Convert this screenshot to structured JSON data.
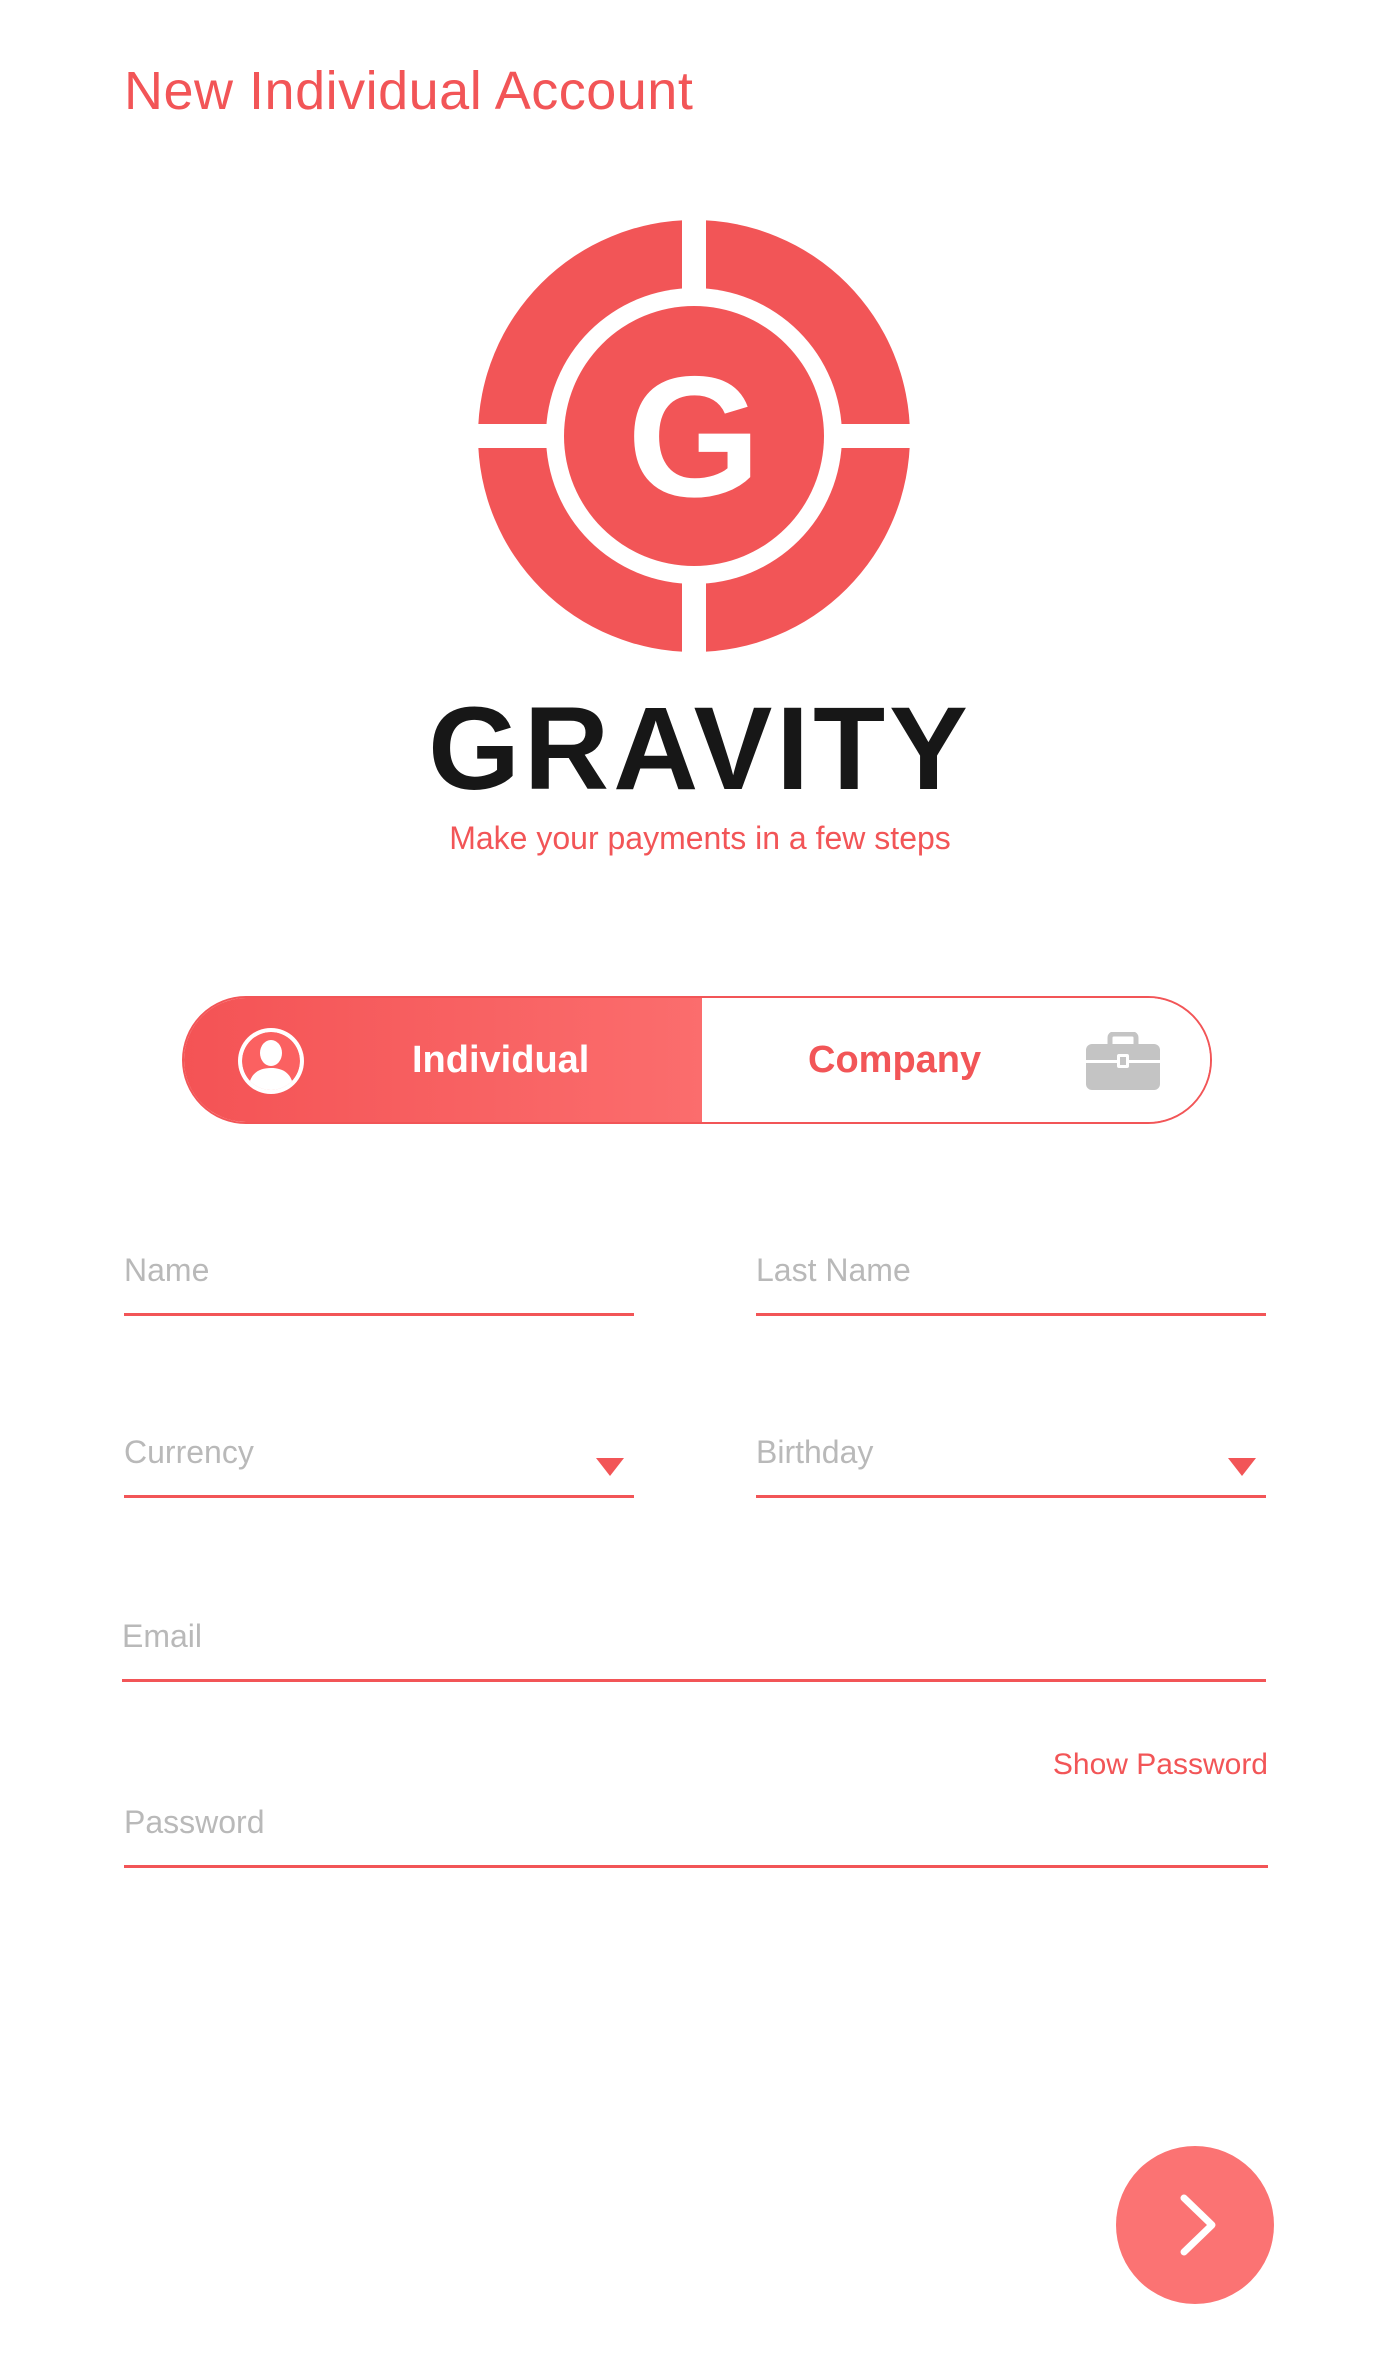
{
  "header": {
    "title": "New Individual Account"
  },
  "brand": {
    "logo_letter": "G",
    "name": "GRAVITY",
    "tagline": "Make your payments in a few steps",
    "color": "#f25557"
  },
  "account_type": {
    "options": [
      {
        "label": "Individual",
        "icon": "person-icon",
        "selected": true
      },
      {
        "label": "Company",
        "icon": "briefcase-icon",
        "selected": false
      }
    ]
  },
  "form": {
    "name": {
      "placeholder": "Name",
      "value": ""
    },
    "last_name": {
      "placeholder": "Last Name",
      "value": ""
    },
    "currency": {
      "placeholder": "Currency",
      "value": "",
      "icon": "dropdown-arrow-icon"
    },
    "birthday": {
      "placeholder": "Birthday",
      "value": "",
      "icon": "dropdown-arrow-icon"
    },
    "email": {
      "placeholder": "Email",
      "value": ""
    },
    "password": {
      "placeholder": "Password",
      "value": ""
    },
    "show_password_label": "Show Password"
  },
  "actions": {
    "next_icon": "chevron-right-icon"
  },
  "colors": {
    "accent": "#f25557",
    "next_button": "#fb7373",
    "placeholder": "#b9b9b9",
    "brand_text": "#171717"
  }
}
